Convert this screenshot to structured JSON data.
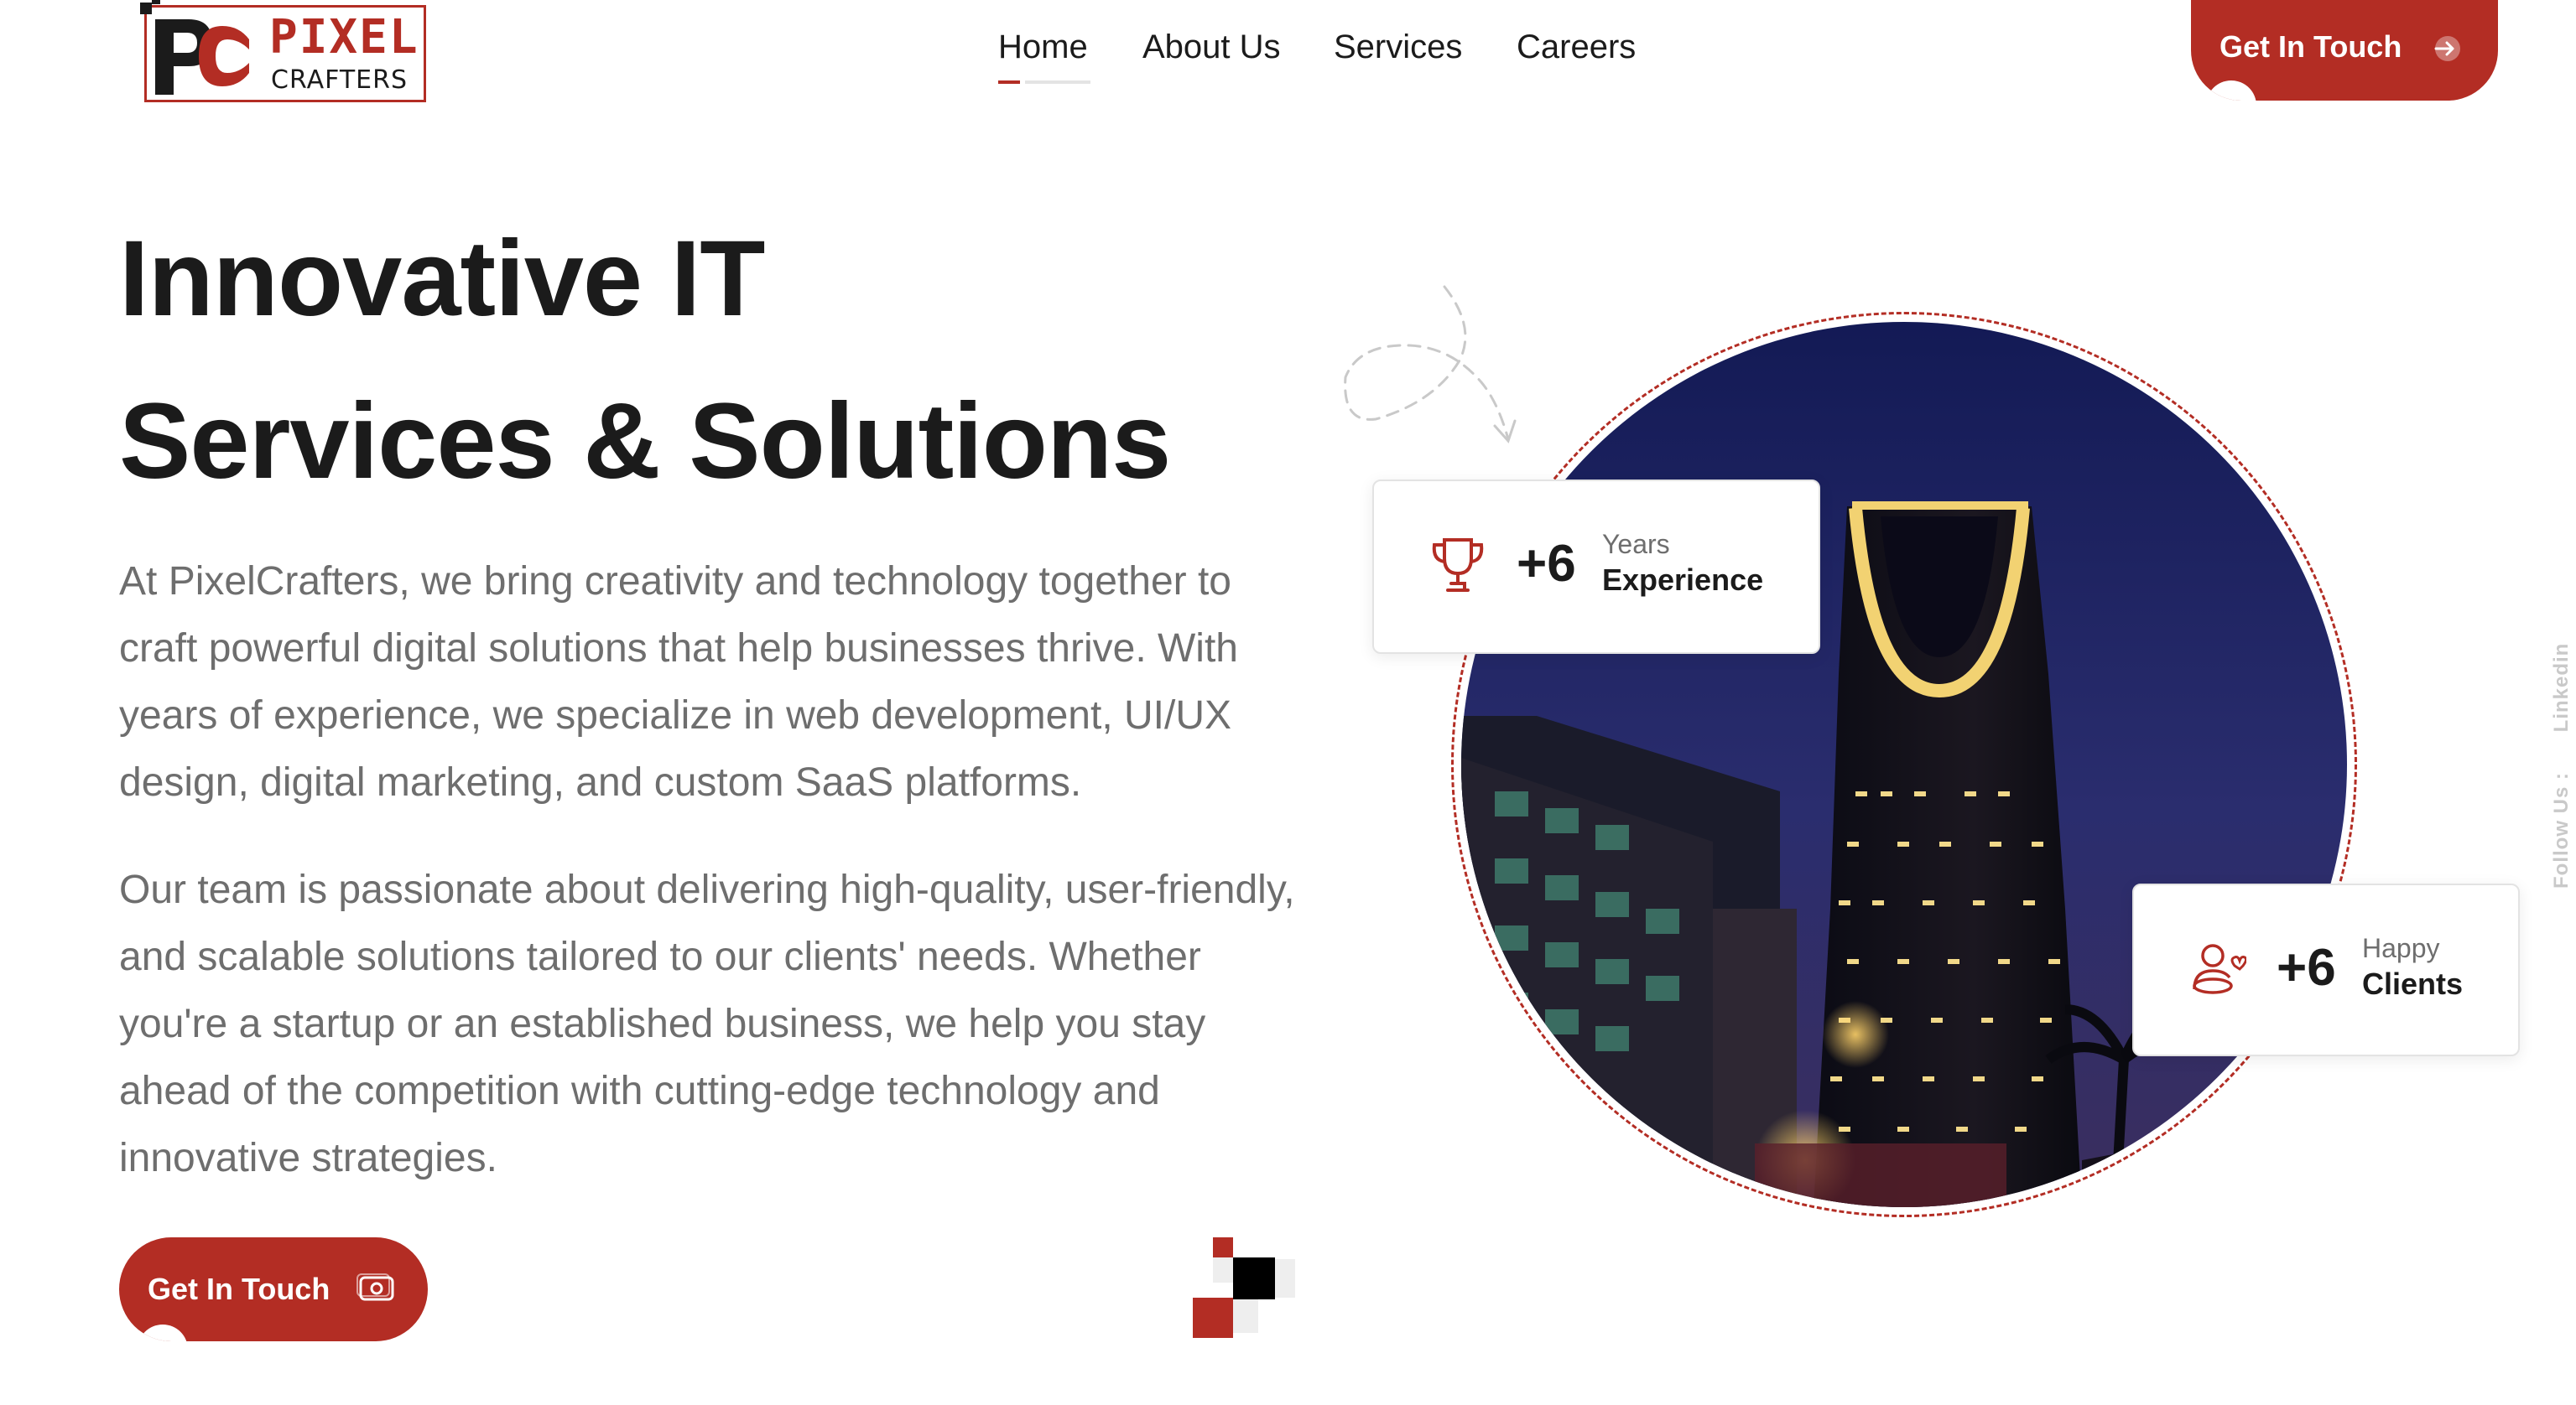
{
  "brand": {
    "name_top": "PIXEL",
    "name_bottom": "CRAFTERS",
    "logo_icon": "pc-pixel-logo"
  },
  "nav": {
    "items": [
      {
        "label": "Home",
        "active": true
      },
      {
        "label": "About Us",
        "active": false
      },
      {
        "label": "Services",
        "active": false
      },
      {
        "label": "Careers",
        "active": false
      }
    ],
    "cta": {
      "label": "Get In Touch",
      "icon": "arrow-right-icon"
    }
  },
  "hero": {
    "title_line1": "Innovative IT",
    "title_line2": "Services & Solutions",
    "paragraph1": "At PixelCrafters, we bring creativity and technology together to craft powerful digital solutions that help businesses thrive. With years of experience, we specialize in web development, UI/UX design, digital marketing, and custom SaaS platforms.",
    "paragraph2": "Our team is passionate about delivering high-quality, user-friendly, and scalable solutions tailored to our clients' needs. Whether you're a startup or an established business, we help you stay ahead of the competition with cutting-edge technology and innovative strategies.",
    "cta": {
      "label": "Get In Touch",
      "icon": "money-icon"
    }
  },
  "stats": {
    "experience": {
      "value": "+6",
      "label_small": "Years",
      "label_big": "Experience",
      "icon": "trophy-icon"
    },
    "clients": {
      "value": "+6",
      "label_small": "Happy",
      "label_big": "Clients",
      "icon": "users-heart-icon"
    }
  },
  "social": {
    "follow_label": "Follow Us :",
    "linkedin_label": "Linkedin"
  },
  "colors": {
    "accent": "#b32d24",
    "text": "#1b1b1b",
    "muted": "#6e6e6e"
  }
}
